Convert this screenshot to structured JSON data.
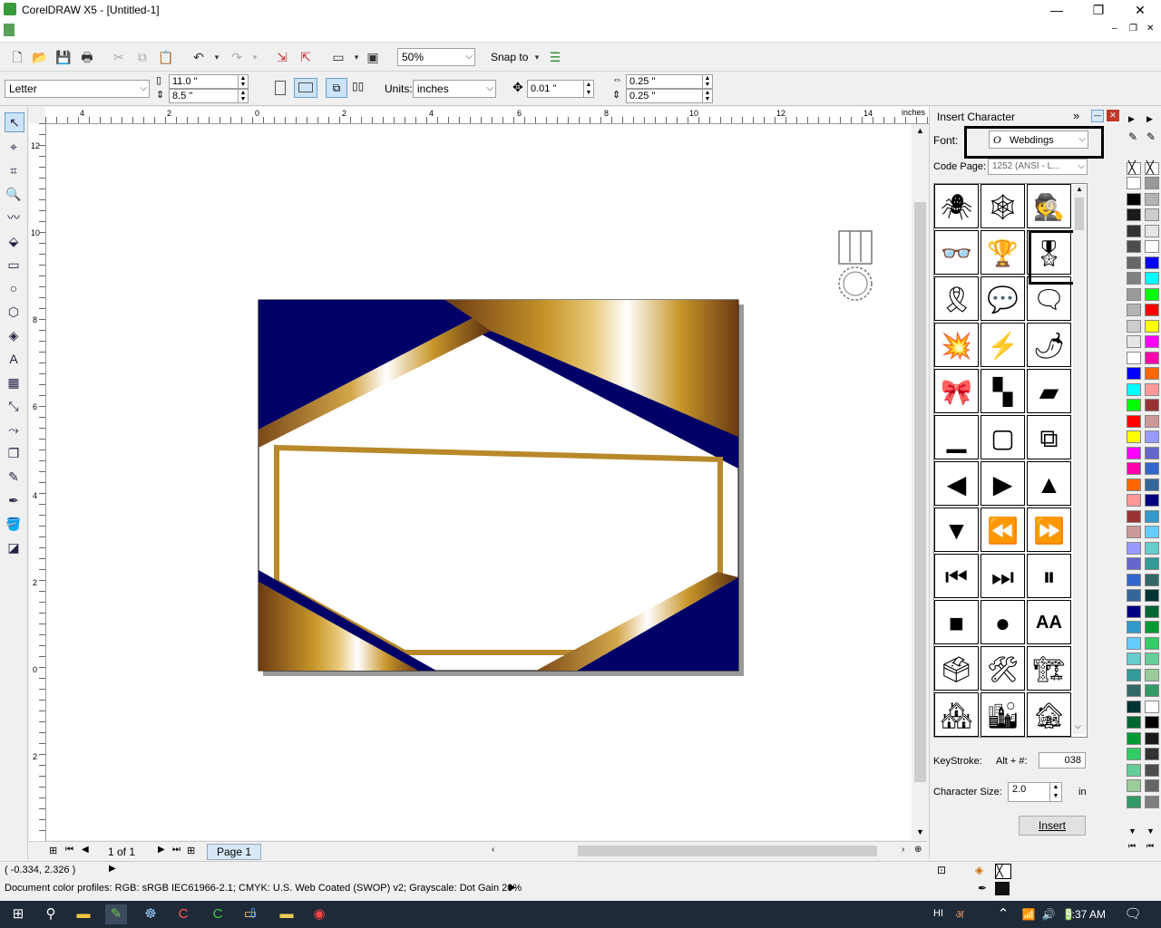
{
  "window": {
    "title": "CorelDRAW X5 - [Untitled-1]",
    "minimize": "—",
    "maximize": "❐",
    "close": "✕"
  },
  "toolbar": {
    "zoom": "50%",
    "snap_to": "Snap to"
  },
  "property_bar": {
    "paper_size": "Letter",
    "width": "11.0 \"",
    "height": "8.5 \"",
    "units_label": "Units:",
    "units": "inches",
    "nudge": "0.01 \"",
    "dup_x": "0.25 \"",
    "dup_y": "0.25 \""
  },
  "rulers": {
    "unit_label": "inches",
    "h_ticks": [
      "4",
      "2",
      "0",
      "2",
      "4",
      "6",
      "8",
      "10",
      "12",
      "14"
    ],
    "v_ticks": [
      "12",
      "10",
      "8",
      "6",
      "4",
      "2",
      "0",
      "2"
    ]
  },
  "page_nav": {
    "page_count": "1 of 1",
    "page_tab": "Page 1"
  },
  "docker": {
    "title": "Insert Character",
    "font_label": "Font:",
    "font_value": "Webdings",
    "code_page_label": "Code Page:",
    "code_page_value": "1252  (ANSI - L...",
    "keystroke_label": "KeyStroke:",
    "keystroke_prefix": "Alt + #:",
    "keystroke_value": "038",
    "char_size_label": "Character Size:",
    "char_size_value": "2.0",
    "char_size_unit": "in",
    "insert_button": "Insert"
  },
  "glyphs": [
    "🕷",
    "🕸",
    "🕵",
    "👓",
    "🏆",
    "🎖",
    "🎗",
    "💬",
    "🗨",
    "💥",
    "⚡",
    "🌶",
    "🎀",
    "▚",
    "▰",
    "▁",
    "▢",
    "⧉",
    "◀",
    "▶",
    "▲",
    "▼",
    "⏪",
    "⏩",
    "⏮",
    "⏭",
    "⏸",
    "■",
    "●",
    "AA",
    "🗳",
    "🛠",
    "🏗",
    "🏘",
    "🏙",
    "🏚"
  ],
  "status": {
    "coords": "( -0.334, 2.326 )",
    "color_profiles": "Document color profiles: RGB: sRGB IEC61966-2.1; CMYK: U.S. Web Coated (SWOP) v2; Grayscale: Dot Gain 20%"
  },
  "taskbar": {
    "lang": "HI",
    "time": "9:37 AM"
  },
  "colors": {
    "navy": "#000066",
    "gold": "#c8962a",
    "accent": "#3399cc"
  },
  "palette": [
    "#ffffff",
    "#000000",
    "#1a1a1a",
    "#333333",
    "#4d4d4d",
    "#666666",
    "#808080",
    "#999999",
    "#b3b3b3",
    "#cccccc",
    "#e6e6e6",
    "#ffffff",
    "#0000ff",
    "#00ffff",
    "#00ff00",
    "#ff0000",
    "#ffff00",
    "#ff00ff",
    "#ff00aa",
    "#ff6600",
    "#ff9999",
    "#993333",
    "#cc9999",
    "#9999ff",
    "#6666cc",
    "#3366cc",
    "#336699",
    "#000080",
    "#3399cc",
    "#66ccff",
    "#66cccc",
    "#339999",
    "#336666",
    "#003333",
    "#006633",
    "#009933",
    "#33cc66",
    "#66cc99",
    "#99cc99",
    "#339966"
  ]
}
